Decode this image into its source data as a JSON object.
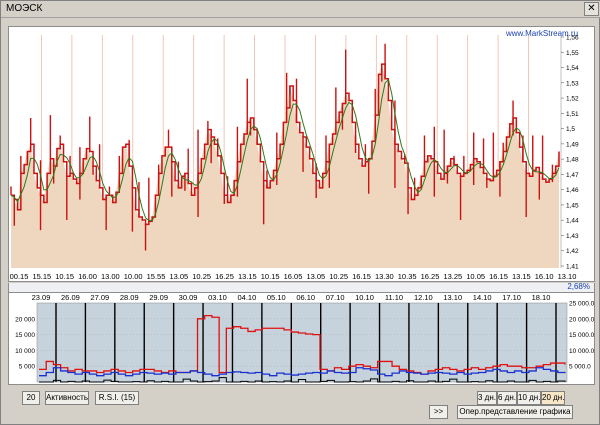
{
  "window": {
    "title": "МОЭСК",
    "close_glyph": "✕"
  },
  "watermark": "www.MarkStream.ru",
  "rate_text": "2,68%",
  "colors": {
    "price_fill": "#efd6bf",
    "price_line": "#cc1111",
    "ma_line": "#2e7a1a",
    "vol_red": "#e01010",
    "vol_blue": "#1a2fd0",
    "vol_black": "#000000",
    "vol_bg": "#c6d3dc"
  },
  "price_axis_ticks": [
    "1,56",
    "1,55",
    "1,54",
    "1,53",
    "1,52",
    "1,51",
    "1,5",
    "1,49",
    "1,48",
    "1,47",
    "1,46",
    "1,45",
    "1,44",
    "1,43",
    "1,42",
    "1,41"
  ],
  "time_labels": [
    "00.15",
    "15.15",
    "10.15",
    "16.00",
    "13.00",
    "10.00",
    "15.55",
    "13.05",
    "10.25",
    "16.25",
    "13.15",
    "10.15",
    "16.05",
    "13.05",
    "10.25",
    "16.15",
    "13.30",
    "10.35",
    "16.25",
    "13.25",
    "10.05",
    "16.15",
    "13.15",
    "16.10",
    "13.10"
  ],
  "date_labels": [
    "23.09",
    "26.09",
    "27.09",
    "28.09",
    "29.09",
    "30.09",
    "03.10",
    "04.10",
    "05.10",
    "06.10",
    "07.10",
    "10.10",
    "11.10",
    "12.10",
    "13.10",
    "14.10",
    "17.10",
    "18.10"
  ],
  "vol_left_ticks": [
    "20 000",
    "15 000",
    "10 000",
    "5 000"
  ],
  "vol_right_ticks": [
    "25 000.0",
    "20 000.0",
    "15 000.0",
    "10 000.0",
    "5 000.0"
  ],
  "controls": {
    "period_value": "20",
    "activity": "Активность",
    "rsi": "R.S.I. (15)",
    "next": ">>",
    "range_3": "3 дн.",
    "range_6": "6 дн.",
    "range_10": "10 дн.",
    "range_20": "20 дн.",
    "opt_view": "Опер.представление графика"
  },
  "chart_data": [
    {
      "type": "line",
      "title": "МОЭСК",
      "ylim": [
        1.405,
        1.565
      ],
      "x_tick_labels": [
        "00.15",
        "15.15",
        "10.15",
        "16.00",
        "13.00",
        "10.00",
        "15.55",
        "13.05",
        "10.25",
        "16.25",
        "13.15",
        "10.15",
        "16.05",
        "13.05",
        "10.25",
        "16.15",
        "13.30",
        "10.35",
        "16.25",
        "13.25",
        "10.05",
        "16.15",
        "13.15",
        "16.10",
        "13.10"
      ],
      "series": [
        {
          "values": [
            1.455,
            1.452,
            1.445,
            1.47,
            1.476,
            1.485,
            1.49,
            1.47,
            1.46,
            1.455,
            1.45,
            1.47,
            1.48,
            1.475,
            1.487,
            1.49,
            1.478,
            1.468,
            1.47,
            1.466,
            1.463,
            1.47,
            1.48,
            1.487,
            1.485,
            1.475,
            1.465,
            1.46,
            1.452,
            1.455,
            1.455,
            1.45,
            1.457,
            1.47,
            1.488,
            1.49,
            1.475,
            1.46,
            1.445,
            1.44,
            1.438,
            1.435,
            1.437,
            1.44,
            1.455,
            1.47,
            1.482,
            1.488,
            1.488,
            1.478,
            1.465,
            1.46,
            1.468,
            1.47,
            1.463,
            1.455,
            1.46,
            1.47,
            1.48,
            1.49,
            1.5,
            1.495,
            1.49,
            1.482,
            1.47,
            1.455,
            1.45,
            1.455,
            1.465,
            1.478,
            1.49,
            1.497,
            1.505,
            1.508,
            1.5,
            1.49,
            1.478,
            1.465,
            1.46,
            1.465,
            1.472,
            1.48,
            1.49,
            1.505,
            1.515,
            1.53,
            1.52,
            1.505,
            1.498,
            1.495,
            1.488,
            1.48,
            1.47,
            1.465,
            1.46,
            1.47,
            1.478,
            1.49,
            1.497,
            1.505,
            1.512,
            1.518,
            1.525,
            1.52,
            1.505,
            1.49,
            1.48,
            1.475,
            1.478,
            1.48,
            1.492,
            1.51,
            1.538,
            1.545,
            1.535,
            1.52,
            1.5,
            1.49,
            1.485,
            1.48,
            1.477,
            1.46,
            1.452,
            1.455,
            1.46,
            1.468,
            1.478,
            1.482,
            1.48,
            1.478,
            1.47,
            1.466,
            1.47,
            1.475,
            1.48,
            1.476,
            1.47,
            1.468,
            1.47,
            1.472,
            1.476,
            1.48,
            1.478,
            1.474,
            1.47,
            1.466,
            1.465,
            1.468,
            1.472,
            1.478,
            1.485,
            1.495,
            1.504,
            1.508,
            1.498,
            1.488,
            1.478,
            1.47,
            1.468,
            1.472,
            1.474,
            1.47,
            1.466,
            1.464,
            1.466,
            1.47,
            1.475,
            1.485
          ]
        }
      ]
    },
    {
      "type": "line",
      "ylim": [
        0,
        25000
      ],
      "x_tick_labels": [
        "23.09",
        "26.09",
        "27.09",
        "28.09",
        "29.09",
        "30.09",
        "03.10",
        "04.10",
        "05.10",
        "06.10",
        "07.10",
        "10.10",
        "11.10",
        "12.10",
        "13.10",
        "14.10",
        "17.10",
        "18.10"
      ],
      "series": [
        {
          "color": "#e01010",
          "values": [
            4000,
            6500,
            5500,
            4500,
            3500,
            4000,
            3500,
            3500,
            3000,
            3500,
            4000,
            3500,
            3000,
            3500,
            4000,
            4000,
            3500,
            3000,
            3500,
            3000,
            3000,
            3500,
            20000,
            21000,
            20500,
            3000,
            17000,
            17500,
            17000,
            16000,
            16500,
            17000,
            17000,
            17000,
            16500,
            15800,
            15500,
            15200,
            15000,
            4000,
            3500,
            4500,
            4000,
            5000,
            5500,
            5000,
            4500,
            6500,
            6500,
            5000,
            4000,
            3500,
            3000,
            2500,
            3500,
            4000,
            4500,
            4000,
            3500,
            4000,
            4500,
            4000,
            4500,
            5000,
            5500,
            5000,
            5000,
            4500,
            4500,
            5000,
            5500,
            6000,
            6000,
            5500
          ]
        },
        {
          "color": "#1a2fd0",
          "values": [
            2000,
            3000,
            4500,
            3500,
            3000,
            2500,
            3000,
            2500,
            2000,
            2500,
            3000,
            2500,
            2000,
            2500,
            3000,
            2800,
            2500,
            2800,
            2500,
            3000,
            3000,
            3500,
            3000,
            2500,
            2000,
            2500,
            3000,
            3200,
            3000,
            2800,
            3000,
            2500,
            2000,
            2800,
            2500,
            2200,
            2500,
            2800,
            3000,
            2800,
            3500,
            3000,
            2800,
            3000,
            4500,
            4200,
            3800,
            2500,
            2000,
            2800,
            3500,
            3000,
            2800,
            2500,
            2800,
            3000,
            2800,
            2500,
            3000,
            2500,
            2800,
            3000,
            3500,
            4000,
            3500,
            3000,
            3500,
            3000,
            3500,
            4500,
            4000,
            3500,
            3000,
            2800
          ]
        },
        {
          "color": "#000000",
          "values": [
            0,
            0,
            500,
            0,
            200,
            0,
            300,
            0,
            0,
            600,
            200,
            0,
            0,
            100,
            0,
            400,
            0,
            200,
            0,
            0,
            900,
            300,
            0,
            100,
            300,
            1400,
            0,
            0,
            200,
            0,
            300,
            0,
            100,
            0,
            300,
            0,
            800,
            0,
            0,
            200,
            500,
            0,
            0,
            100,
            0,
            300,
            1000,
            0,
            0,
            200,
            0,
            400,
            0,
            0,
            300,
            0,
            200,
            900,
            0,
            0,
            100,
            0,
            400,
            0,
            0,
            300,
            0,
            0,
            500,
            0,
            200,
            0,
            300,
            0
          ]
        }
      ]
    }
  ]
}
